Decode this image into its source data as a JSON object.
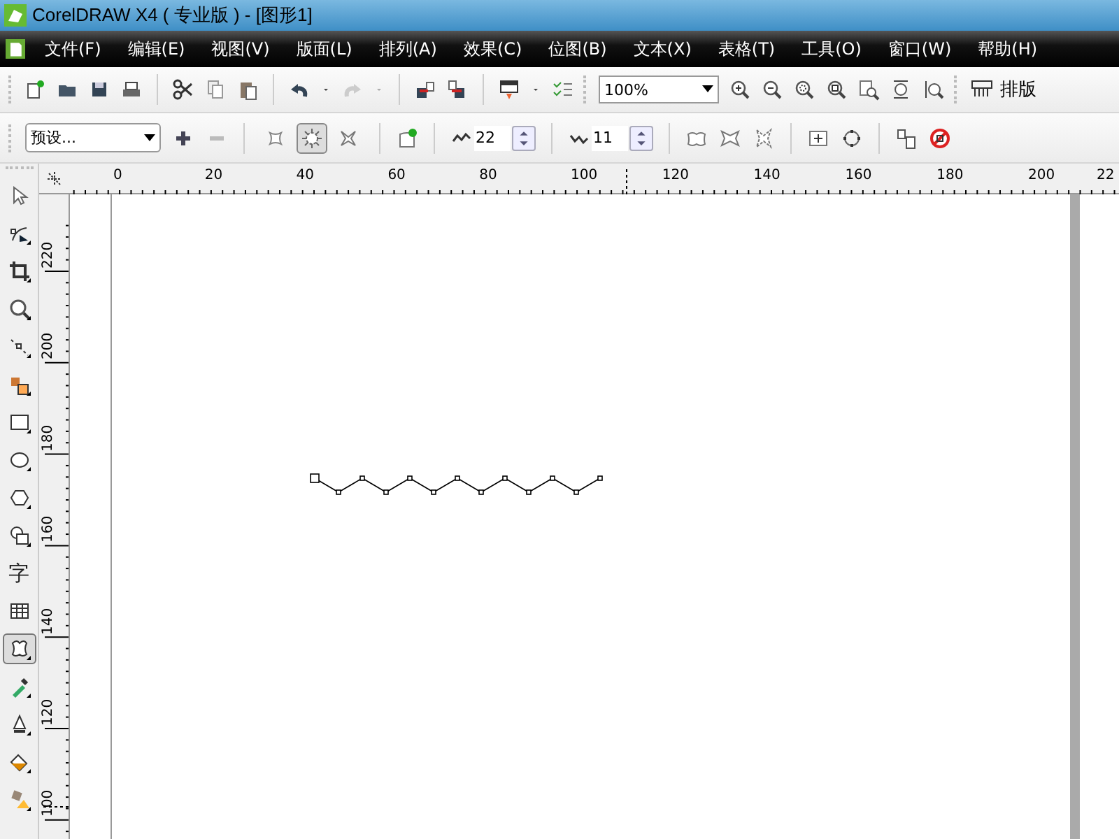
{
  "window": {
    "title": "CorelDRAW X4 ( 专业版 ) - [图形1]"
  },
  "menu": [
    "文件(F)",
    "编辑(E)",
    "视图(V)",
    "版面(L)",
    "排列(A)",
    "效果(C)",
    "位图(B)",
    "文本(X)",
    "表格(T)",
    "工具(O)",
    "窗口(W)",
    "帮助(H)"
  ],
  "standard_toolbar": {
    "zoom": "100%",
    "layout_button": "排版"
  },
  "property_bar": {
    "preset": "预设...",
    "shape_modes": [
      {
        "selected": false
      },
      {
        "selected": true
      },
      {
        "selected": false
      }
    ],
    "point_frequency": "22",
    "amplitude": "11"
  },
  "toolbox": [
    {
      "selected": false
    },
    {
      "selected": false
    },
    {
      "selected": false
    },
    {
      "selected": false
    },
    {
      "selected": false
    },
    {
      "selected": false
    },
    {
      "selected": false
    },
    {
      "selected": false
    },
    {
      "selected": false
    },
    {
      "selected": false
    },
    {
      "selected": false,
      "label": "字"
    },
    {
      "selected": false
    },
    {
      "selected": true
    },
    {
      "selected": false
    },
    {
      "selected": false
    },
    {
      "selected": false
    },
    {
      "selected": false
    }
  ],
  "horizontal_ruler": [
    "0",
    "20",
    "40",
    "60",
    "80",
    "100",
    "120",
    "140",
    "160",
    "180",
    "200",
    "22"
  ],
  "vertical_ruler": [
    "220",
    "200",
    "180",
    "160",
    "140",
    "120",
    "100"
  ]
}
